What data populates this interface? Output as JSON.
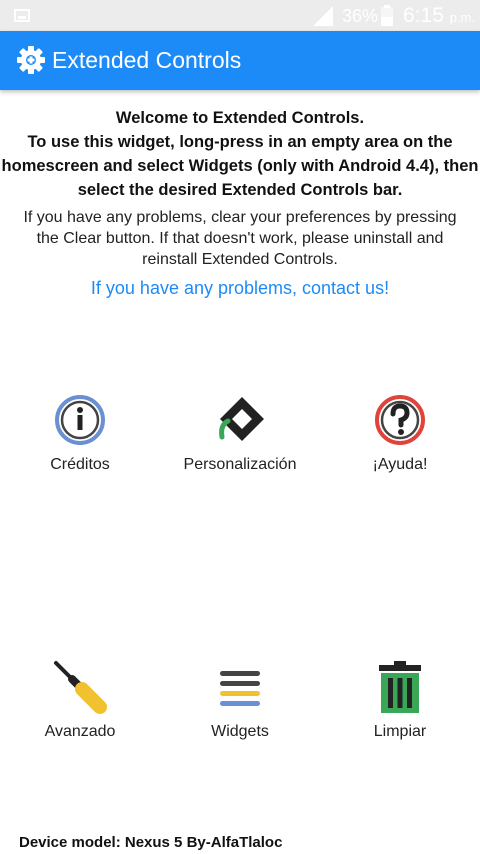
{
  "status_bar": {
    "battery_percent": "36%",
    "time": "6:15",
    "ampm": "p.m."
  },
  "app_bar": {
    "title": "Extended Controls"
  },
  "intro": {
    "heading_lines": [
      "Welcome to Extended Controls.",
      "To use this widget, long-press in an empty area on the",
      "homescreen and select Widgets (only with Android 4.4), then",
      "select the desired Extended Controls bar."
    ],
    "help_lines": [
      "If you have any problems, clear your preferences by pressing",
      "the Clear button. If that doesn't work, please uninstall and",
      "reinstall Extended Controls."
    ],
    "contact_link": "If you have any problems, contact us!"
  },
  "tiles": [
    {
      "label": "Créditos",
      "icon": "info-icon"
    },
    {
      "label": "Personalización",
      "icon": "paint-icon"
    },
    {
      "label": "¡Ayuda!",
      "icon": "help-icon"
    },
    {
      "label": "Avanzado",
      "icon": "screwdriver-icon"
    },
    {
      "label": "Widgets",
      "icon": "widgets-icon"
    },
    {
      "label": "Limpiar",
      "icon": "trash-icon"
    }
  ],
  "footer": {
    "device": "Device model: Nexus 5 By-AlfaTlaloc"
  },
  "colors": {
    "accent": "#1d8bf7",
    "status_bar": "#ececec"
  }
}
